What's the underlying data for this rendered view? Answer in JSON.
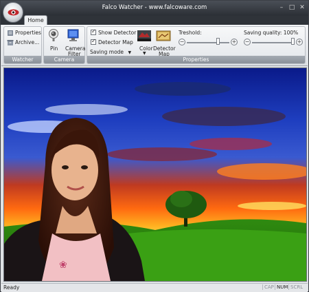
{
  "window": {
    "title": "Falco Watcher - www.falcoware.com",
    "minimize_glyph": "–",
    "maximize_glyph": "□",
    "close_glyph": "✕"
  },
  "tabs": [
    {
      "label": "Home",
      "selected": true
    }
  ],
  "ribbon": {
    "watcher": {
      "label": "Watcher",
      "properties": "Properties",
      "archive": "Archive..."
    },
    "camera": {
      "label": "Camera",
      "pin": "Pin",
      "camera_filter_line1": "Camera",
      "camera_filter_line2": "Filter"
    },
    "properties": {
      "label": "Properties",
      "show_detector": {
        "label": "Show Detector",
        "checked": true
      },
      "detector_map": {
        "label": "Detector Map",
        "checked": true
      },
      "saving_mode": "Saving mode",
      "color": "Color",
      "detector_map_btn_line1": "Detector",
      "detector_map_btn_line2": "Map",
      "treshold_label": "Treshold:",
      "treshold_value": 0.75,
      "saving_quality_label": "Saving quality: 100%",
      "saving_quality_value": 1.0
    }
  },
  "status": {
    "text": "Ready",
    "indicators": [
      {
        "label": "CAP",
        "active": false
      },
      {
        "label": "NUM",
        "active": true
      },
      {
        "label": "SCRL",
        "active": false
      }
    ]
  },
  "colors": {
    "titlebar": "#2b2f35",
    "ribbon_group_label": "#8a9099",
    "accent_red": "#c0262b"
  }
}
